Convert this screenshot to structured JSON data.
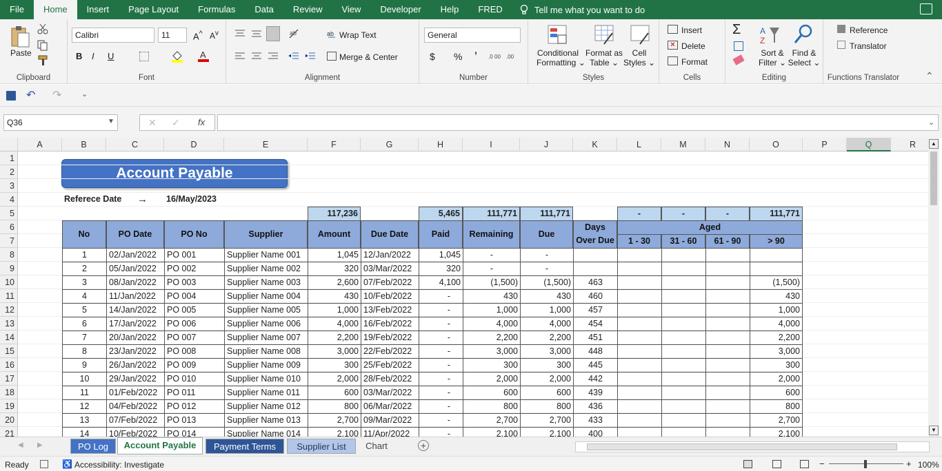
{
  "menu": {
    "items": [
      "File",
      "Home",
      "Insert",
      "Page Layout",
      "Formulas",
      "Data",
      "Review",
      "View",
      "Developer",
      "Help",
      "FRED"
    ],
    "active": "Home",
    "tell_me": "Tell me what you want to do"
  },
  "ribbon": {
    "clipboard": {
      "label": "Clipboard",
      "paste": "Paste"
    },
    "font": {
      "label": "Font",
      "name": "Calibri",
      "size": "11",
      "bold": "B",
      "italic": "I",
      "underline": "U"
    },
    "alignment": {
      "label": "Alignment",
      "wrap": "Wrap Text",
      "merge": "Merge & Center"
    },
    "number": {
      "label": "Number",
      "format": "General",
      "currency": "$",
      "percent": "%",
      "comma": "’"
    },
    "styles": {
      "label": "Styles",
      "conditional_1": "Conditional",
      "conditional_2": "Formatting",
      "format_table_1": "Format as",
      "format_table_2": "Table",
      "cell_styles_1": "Cell",
      "cell_styles_2": "Styles"
    },
    "cells": {
      "label": "Cells",
      "insert": "Insert",
      "delete": "Delete",
      "format": "Format"
    },
    "editing": {
      "label": "Editing",
      "sort_1": "Sort &",
      "sort_2": "Filter",
      "find_1": "Find &",
      "find_2": "Select"
    },
    "translator": {
      "label": "Functions Translator",
      "reference": "Reference",
      "translator": "Translator"
    }
  },
  "formula_bar": {
    "name_box": "Q36",
    "formula": "",
    "fx": "fx"
  },
  "columns": [
    "A",
    "B",
    "C",
    "D",
    "E",
    "F",
    "G",
    "H",
    "I",
    "J",
    "K",
    "L",
    "M",
    "N",
    "O",
    "P",
    "Q",
    "R"
  ],
  "selected_column": "Q",
  "rows": [
    "1",
    "2",
    "3",
    "4",
    "5",
    "6",
    "7",
    "8",
    "9",
    "10",
    "11",
    "12",
    "13",
    "14",
    "15",
    "16",
    "17",
    "18",
    "19",
    "20",
    "21"
  ],
  "sheet": {
    "title": "Account Payable",
    "ref_label": "Referece Date",
    "ref_arrow": "→",
    "ref_date": "16/May/2023",
    "totals": {
      "amount": "117,236",
      "paid": "5,465",
      "remaining": "111,771",
      "due": "111,771",
      "a1": "-",
      "a2": "-",
      "a3": "-",
      "a4": "111,771"
    },
    "headers": {
      "no": "No",
      "po_date": "PO Date",
      "po_no": "PO No",
      "supplier": "Supplier",
      "amount": "Amount",
      "due_date": "Due Date",
      "paid": "Paid",
      "remaining": "Remaining",
      "due": "Due",
      "days_1": "Days",
      "days_2": "Over Due",
      "aged": "Aged",
      "b1": "1 - 30",
      "b2": "31 - 60",
      "b3": "61 - 90",
      "b4": "> 90"
    },
    "data": [
      [
        "1",
        "02/Jan/2022",
        "PO 001",
        "Supplier Name 001",
        "1,045",
        "12/Jan/2022",
        "1,045",
        "-",
        "-",
        "",
        "",
        ""
      ],
      [
        "2",
        "05/Jan/2022",
        "PO 002",
        "Supplier Name 002",
        "320",
        "03/Mar/2022",
        "320",
        "-",
        "-",
        "",
        "",
        ""
      ],
      [
        "3",
        "08/Jan/2022",
        "PO 003",
        "Supplier Name 003",
        "2,600",
        "07/Feb/2022",
        "4,100",
        "(1,500)",
        "(1,500)",
        "463",
        "(1,500)"
      ],
      [
        "4",
        "11/Jan/2022",
        "PO 004",
        "Supplier Name 004",
        "430",
        "10/Feb/2022",
        "-",
        "430",
        "430",
        "460",
        "430"
      ],
      [
        "5",
        "14/Jan/2022",
        "PO 005",
        "Supplier Name 005",
        "1,000",
        "13/Feb/2022",
        "-",
        "1,000",
        "1,000",
        "457",
        "1,000"
      ],
      [
        "6",
        "17/Jan/2022",
        "PO 006",
        "Supplier Name 006",
        "4,000",
        "16/Feb/2022",
        "-",
        "4,000",
        "4,000",
        "454",
        "4,000"
      ],
      [
        "7",
        "20/Jan/2022",
        "PO 007",
        "Supplier Name 007",
        "2,200",
        "19/Feb/2022",
        "-",
        "2,200",
        "2,200",
        "451",
        "2,200"
      ],
      [
        "8",
        "23/Jan/2022",
        "PO 008",
        "Supplier Name 008",
        "3,000",
        "22/Feb/2022",
        "-",
        "3,000",
        "3,000",
        "448",
        "3,000"
      ],
      [
        "9",
        "26/Jan/2022",
        "PO 009",
        "Supplier Name 009",
        "300",
        "25/Feb/2022",
        "-",
        "300",
        "300",
        "445",
        "300"
      ],
      [
        "10",
        "29/Jan/2022",
        "PO 010",
        "Supplier Name 010",
        "2,000",
        "28/Feb/2022",
        "-",
        "2,000",
        "2,000",
        "442",
        "2,000"
      ],
      [
        "11",
        "01/Feb/2022",
        "PO 011",
        "Supplier Name 011",
        "600",
        "03/Mar/2022",
        "-",
        "600",
        "600",
        "439",
        "600"
      ],
      [
        "12",
        "04/Feb/2022",
        "PO 012",
        "Supplier Name 012",
        "800",
        "06/Mar/2022",
        "-",
        "800",
        "800",
        "436",
        "800"
      ],
      [
        "13",
        "07/Feb/2022",
        "PO 013",
        "Supplier Name 013",
        "2,700",
        "09/Mar/2022",
        "-",
        "2,700",
        "2,700",
        "433",
        "2,700"
      ],
      [
        "14",
        "10/Feb/2022",
        "PO 014",
        "Supplier Name 014",
        "2,100",
        "11/Apr/2022",
        "-",
        "2,100",
        "2,100",
        "400",
        "2,100"
      ]
    ]
  },
  "tabs": [
    {
      "label": "PO Log",
      "bg": "#4472c4",
      "fg": "#ffffff"
    },
    {
      "label": "Account Payable",
      "bg": "#ffffff",
      "fg": "#217346"
    },
    {
      "label": "Payment Terms",
      "bg": "#2f5597",
      "fg": "#ffffff"
    },
    {
      "label": "Supplier List",
      "bg": "#b4c6e7",
      "fg": "#1f3864"
    },
    {
      "label": "Chart",
      "bg": "#f0f0f0",
      "fg": "#444444"
    }
  ],
  "status": {
    "ready": "Ready",
    "accessibility": "Accessibility: Investigate",
    "zoom": "100%"
  }
}
